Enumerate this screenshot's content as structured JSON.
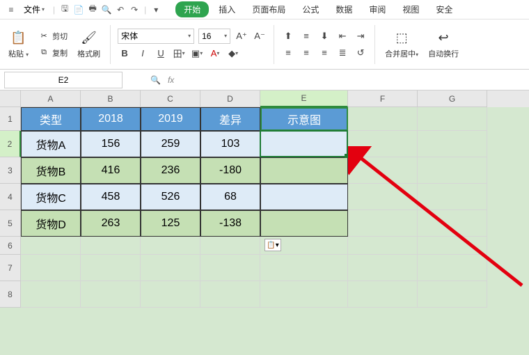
{
  "menu": {
    "file": "文件",
    "tabs": [
      "开始",
      "插入",
      "页面布局",
      "公式",
      "数据",
      "审阅",
      "视图",
      "安全"
    ],
    "active_tab_index": 0
  },
  "ribbon": {
    "paste": "粘贴",
    "cut": "剪切",
    "copy": "复制",
    "format_painter": "格式刷",
    "font_name": "宋体",
    "font_size": "16",
    "merge_center": "合并居中",
    "wrap_text": "自动换行"
  },
  "formula_bar": {
    "cell_ref": "E2",
    "fx": "fx"
  },
  "grid": {
    "columns": [
      "A",
      "B",
      "C",
      "D",
      "E",
      "F",
      "G"
    ],
    "row_labels": [
      "1",
      "2",
      "3",
      "4",
      "5",
      "6",
      "7",
      "8"
    ],
    "header_row": {
      "type": "类型",
      "y2018": "2018",
      "y2019": "2019",
      "diff": "差异",
      "chart": "示意图"
    },
    "data": [
      {
        "type": "货物A",
        "y2018": "156",
        "y2019": "259",
        "diff": "103"
      },
      {
        "type": "货物B",
        "y2018": "416",
        "y2019": "236",
        "diff": "-180"
      },
      {
        "type": "货物C",
        "y2018": "458",
        "y2019": "526",
        "diff": "68"
      },
      {
        "type": "货物D",
        "y2018": "263",
        "y2019": "125",
        "diff": "-138"
      }
    ],
    "paste_options_icon": "📋"
  },
  "chart_data": {
    "type": "table",
    "title": "",
    "columns": [
      "类型",
      "2018",
      "2019",
      "差异"
    ],
    "rows": [
      [
        "货物A",
        156,
        259,
        103
      ],
      [
        "货物B",
        416,
        236,
        -180
      ],
      [
        "货物C",
        458,
        526,
        68
      ],
      [
        "货物D",
        263,
        125,
        -138
      ]
    ]
  }
}
